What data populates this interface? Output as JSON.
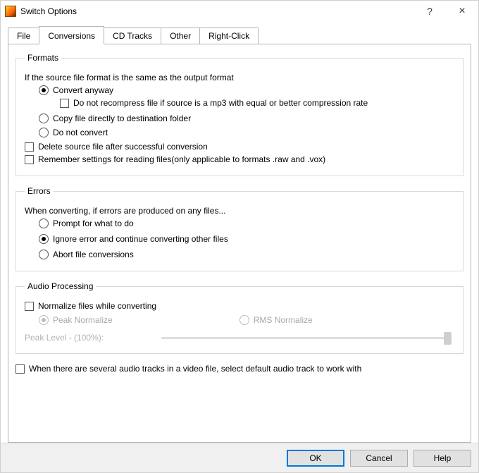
{
  "title": "Switch Options",
  "titlebar": {
    "help_tooltip": "?",
    "close_tooltip": "×"
  },
  "tabs": {
    "file": "File",
    "conversions": "Conversions",
    "cd_tracks": "CD Tracks",
    "other": "Other",
    "right_click": "Right-Click"
  },
  "formats": {
    "legend": "Formats",
    "intro": "If the source file format is the same as the output format",
    "convert_anyway": "Convert anyway",
    "do_not_recompress": "Do not recompress file if source is a mp3 with equal or better compression rate",
    "copy_direct": "Copy file directly to destination folder",
    "do_not_convert": "Do not convert",
    "delete_source": "Delete source file after successful conversion",
    "remember_settings": "Remember settings for reading files(only applicable to formats .raw and .vox)"
  },
  "errors": {
    "legend": "Errors",
    "intro": "When converting, if errors are produced on any files...",
    "prompt": "Prompt for what to do",
    "ignore": "Ignore error and continue converting other files",
    "abort": "Abort file conversions"
  },
  "audio": {
    "legend": "Audio Processing",
    "normalize": "Normalize files while converting",
    "peak_normalize": "Peak Normalize",
    "rms_normalize": "RMS Normalize",
    "peak_level_label": "Peak Level - (100%):"
  },
  "bottom": {
    "several_tracks": "When there are several audio tracks in a video file, select default audio track to work with"
  },
  "buttons": {
    "ok": "OK",
    "cancel": "Cancel",
    "help": "Help"
  },
  "state": {
    "active_tab": "conversions",
    "formats_radio": "convert_anyway",
    "do_not_recompress_checked": false,
    "delete_source_checked": false,
    "remember_settings_checked": false,
    "errors_radio": "ignore",
    "normalize_checked": false,
    "normalize_mode": "peak",
    "normalize_disabled": true,
    "peak_level_percent": 100,
    "several_tracks_checked": false
  }
}
